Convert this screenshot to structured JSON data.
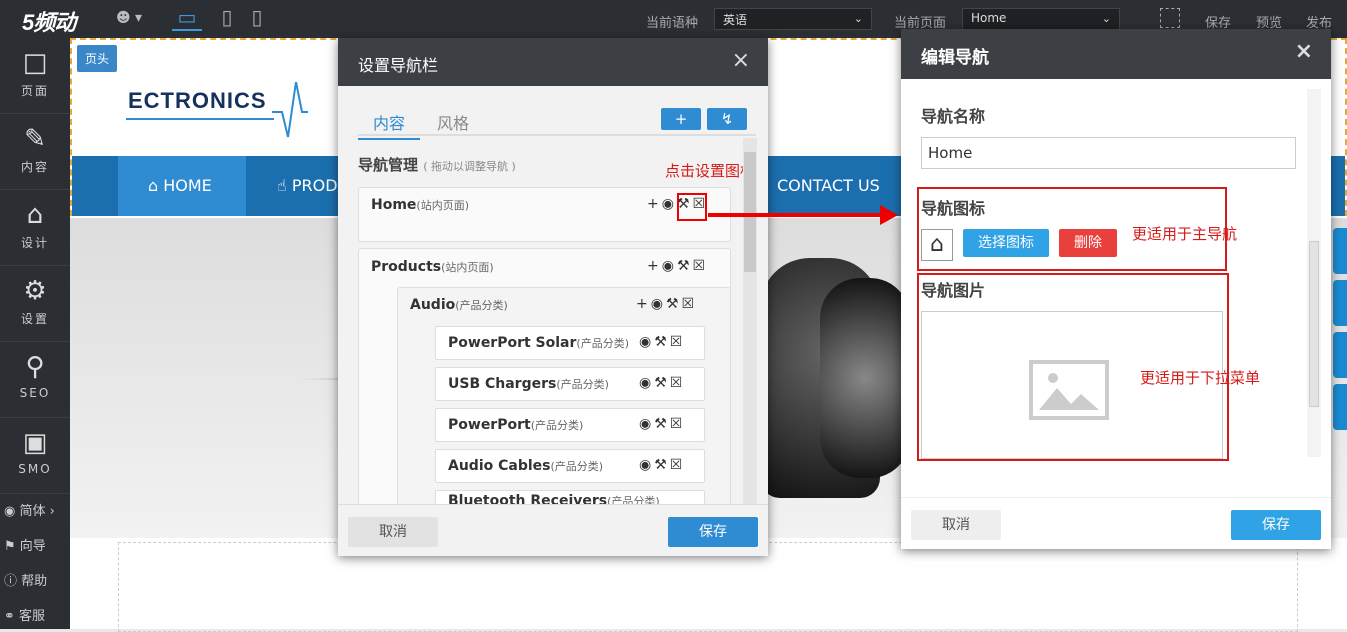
{
  "topbar": {
    "logo": "5频动",
    "lang_label": "当前语种",
    "lang_value": "英语",
    "page_label": "当前页面",
    "page_value": "Home",
    "save": "保存",
    "preview": "预览",
    "publish": "发布"
  },
  "sidebar": {
    "items": [
      {
        "icon": "page-icon",
        "label": "页面"
      },
      {
        "icon": "pencil-icon",
        "label": "内容"
      },
      {
        "icon": "store-icon",
        "label": "设计"
      },
      {
        "icon": "gear-icon",
        "label": "设置"
      },
      {
        "icon": "search-icon",
        "label": "SEO"
      },
      {
        "icon": "briefcase-icon",
        "label": "SMO"
      }
    ],
    "bottom": [
      {
        "icon": "globe-icon",
        "label": "简体 ›"
      },
      {
        "icon": "flag-icon",
        "label": "向导"
      },
      {
        "icon": "help-icon",
        "label": "帮助"
      },
      {
        "icon": "headset-icon",
        "label": "客服"
      }
    ]
  },
  "canvas": {
    "header_tag": "页头",
    "brand": "ECTRONICS",
    "nav": [
      "HOME",
      "PROD",
      "CONTACT US"
    ]
  },
  "nav_modal": {
    "title": "设置导航栏",
    "tabs": [
      "内容",
      "风格"
    ],
    "section_title": "导航管理",
    "section_hint": "( 拖动以调整导航 )",
    "annotation": "点击设置图标",
    "rows": [
      {
        "name": "Home",
        "type": "(站内页面)"
      },
      {
        "name": "Products",
        "type": "(站内页面)"
      }
    ],
    "sub": {
      "name": "Audio",
      "type": "(产品分类)"
    },
    "subsub": [
      {
        "name": "PowerPort Solar",
        "type": "(产品分类)"
      },
      {
        "name": "USB Chargers",
        "type": "(产品分类)"
      },
      {
        "name": "PowerPort",
        "type": "(产品分类)"
      },
      {
        "name": "Audio Cables",
        "type": "(产品分类)"
      },
      {
        "name": "Bluetooth Receivers",
        "type": "(产品分类)"
      }
    ],
    "cancel": "取消",
    "save": "保存"
  },
  "edit_modal": {
    "title": "编辑导航",
    "name_label": "导航名称",
    "name_value": "Home",
    "icon_label": "导航图标",
    "choose_icon": "选择图标",
    "delete": "删除",
    "icon_note": "更适用于主导航",
    "image_label": "导航图片",
    "image_note": "更适用于下拉菜单",
    "cancel": "取消",
    "save": "保存"
  },
  "colors": {
    "accent": "#2f8bd2",
    "danger": "#e8413d",
    "annotation": "#d51a1a",
    "dark": "#2b2e33"
  }
}
